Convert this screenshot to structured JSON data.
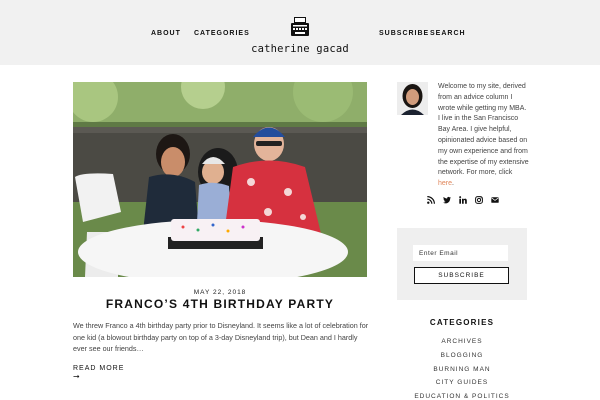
{
  "nav": {
    "about": "ABOUT",
    "categories": "CATEGORIES",
    "subscribe": "SUBSCRIBE",
    "search": "SEARCH"
  },
  "logo": {
    "text": "catherine gacad",
    "icon": "typewriter-icon"
  },
  "post": {
    "date": "MAY 22, 2018",
    "title": "FRANCO’S 4TH BIRTHDAY PARTY",
    "excerpt": "We threw Franco a 4th birthday party prior to Disneyland. It seems like a lot of celebration for one kid (a blowout birthday party on top of a 3-day Disneyland trip), but Dean and I hardly ever see our friends…",
    "read_more": "READ MORE",
    "read_more_arrow": "➞"
  },
  "sidebar": {
    "bio_text": "Welcome to my site, derived from an advice column I wrote while getting my MBA. I live in the San Francisco Bay Area. I give helpful, opinionated advice based on my own experience and from the expertise of my extensive network. For more, click ",
    "bio_link": "here",
    "bio_end": ".",
    "social_icons": [
      "rss-icon",
      "twitter-icon",
      "linkedin-icon",
      "instagram-icon",
      "email-icon"
    ],
    "email_placeholder": "Enter Email",
    "subscribe_button": "SUBSCRIBE",
    "categories_heading": "CATEGORIES",
    "categories": [
      "ARCHIVES",
      "BLOGGING",
      "BURNING MAN",
      "CITY GUIDES",
      "EDUCATION & POLITICS"
    ]
  },
  "colors": {
    "header_bg": "#f1f1f1",
    "accent_link": "#e0865a",
    "subscribe_bg": "#efefef"
  }
}
